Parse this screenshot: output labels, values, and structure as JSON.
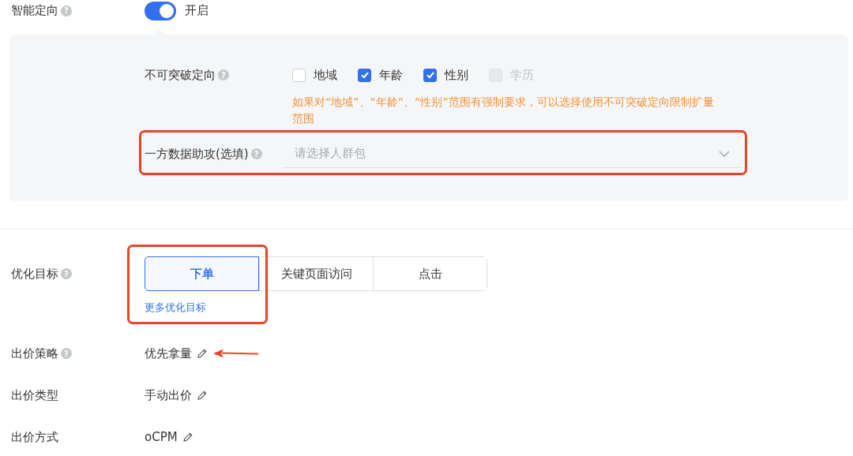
{
  "smart_targeting": {
    "label": "智能定向",
    "help": "?",
    "on": true,
    "state_text": "开启"
  },
  "panel": {
    "unbreakable": {
      "label": "不可突破定向",
      "help": "?",
      "options": [
        {
          "label": "地域",
          "checked": false,
          "disabled": false
        },
        {
          "label": "年龄",
          "checked": true,
          "disabled": false
        },
        {
          "label": "性别",
          "checked": true,
          "disabled": false
        },
        {
          "label": "学历",
          "checked": false,
          "disabled": true
        }
      ],
      "hint": "如果对“地域”、“年龄”、“性别”范围有强制要求，可以选择使用不可突破定向限制扩量范围"
    },
    "first_party": {
      "label": "一方数据助攻(选填)",
      "help": "?",
      "placeholder": "请选择人群包",
      "highlighted": true
    }
  },
  "optimization": {
    "label": "优化目标",
    "help": "?",
    "highlighted": true,
    "options": [
      {
        "label": "下单",
        "selected": true
      },
      {
        "label": "关键页面访问",
        "selected": false
      },
      {
        "label": "点击",
        "selected": false
      }
    ],
    "more_link": "更多优化目标"
  },
  "bid_rows": [
    {
      "label": "出价策略",
      "help": "?",
      "value": "优先拿量",
      "arrow": true
    },
    {
      "label": "出价类型",
      "value": "手动出价",
      "arrow": false
    },
    {
      "label": "出价方式",
      "value": "oCPM",
      "arrow": false
    }
  ]
}
